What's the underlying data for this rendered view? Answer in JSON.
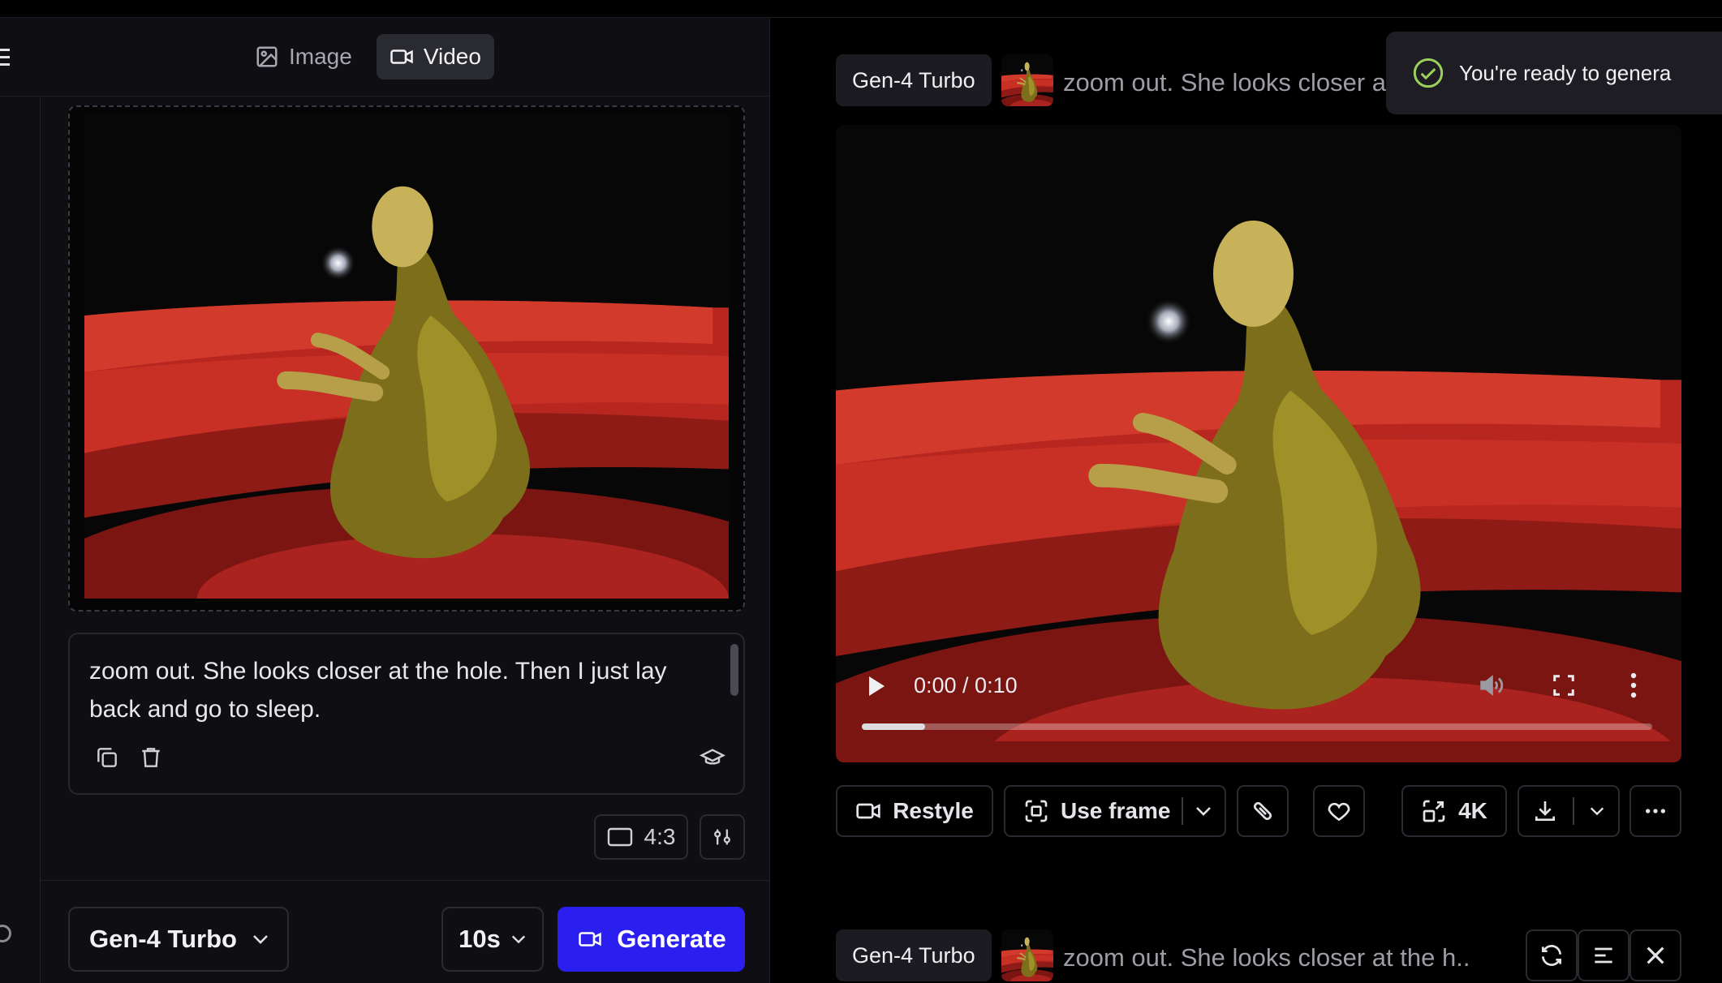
{
  "left_panel": {
    "mode_tabs": [
      {
        "label": "Image",
        "icon": "image-icon",
        "active": false
      },
      {
        "label": "Video",
        "icon": "video-icon",
        "active": true
      }
    ],
    "prompt_text": "zoom out. She looks closer at the hole. Then I just lay back and go to sleep.",
    "aspect_ratio": "4:3",
    "model": "Gen-4 Turbo",
    "duration": "10s",
    "generate_label": "Generate"
  },
  "right_panel": {
    "toast_text": "You're ready to genera",
    "current": {
      "model_chip": "Gen-4 Turbo",
      "prompt_preview": "zoom out. She looks closer at th"
    },
    "video": {
      "time": "0:00 / 0:10",
      "progress_fraction": 0.08
    },
    "actions": {
      "restyle": "Restyle",
      "use_frame": "Use frame",
      "upscale": "4K"
    },
    "next": {
      "model_chip": "Gen-4 Turbo",
      "prompt_preview": "zoom out. She looks closer at the h..."
    }
  },
  "colors": {
    "accent": "#2b1ff0",
    "panel_bg": "#0f0f13",
    "toast_check": "#9bd05c"
  }
}
